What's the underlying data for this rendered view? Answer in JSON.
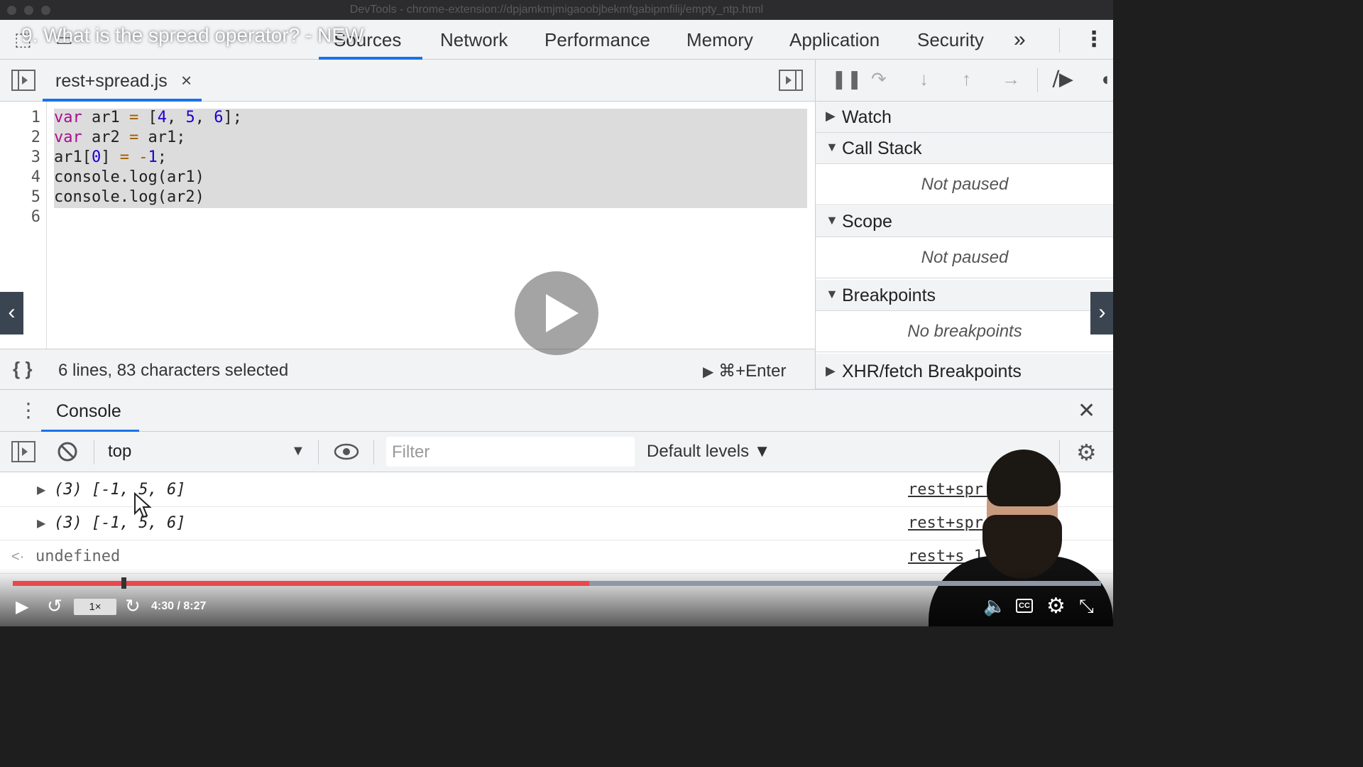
{
  "window": {
    "title": "DevTools - chrome-extension://dpjamkmjmigaoobjbekmfgabipmfilij/empty_ntp.html"
  },
  "video": {
    "title": "9. What is the spread operator? - NEW"
  },
  "devtools_tabs": [
    {
      "label": "Sources",
      "visible_text": "Sources"
    },
    {
      "label": "Network"
    },
    {
      "label": "Performance"
    },
    {
      "label": "Memory"
    },
    {
      "label": "Application"
    },
    {
      "label": "Security"
    }
  ],
  "more_tabs": "»",
  "editor": {
    "file_name": "rest+spread.js",
    "close_glyph": "×",
    "line_numbers": [
      "1",
      "2",
      "3",
      "4",
      "5",
      "6"
    ]
  },
  "status": {
    "selection": "6 lines, 83 characters selected",
    "run_shortcut": "⌘+Enter",
    "braces": "{ }"
  },
  "debugger": {
    "sections": [
      {
        "label": "Watch",
        "expanded": false
      },
      {
        "label": "Call Stack",
        "expanded": true,
        "body": "Not paused"
      },
      {
        "label": "Scope",
        "expanded": true,
        "body": "Not paused"
      },
      {
        "label": "Breakpoints",
        "expanded": true,
        "body": "No breakpoints"
      },
      {
        "label": "XHR/fetch Breakpoints",
        "expanded": false
      }
    ]
  },
  "console": {
    "tab_label": "Console",
    "context": "top",
    "filter_placeholder": "Filter",
    "levels": "Default levels ▼",
    "rows": [
      {
        "value": "(3) [-1, 5, 6]",
        "source": "rest+spr     :4"
      },
      {
        "value": "(3) [-1, 5, 6]",
        "source": "rest+spr     s:5"
      },
      {
        "value": "undefined",
        "source": "rest+s       1"
      }
    ]
  },
  "player": {
    "speed": "1×",
    "time": "4:30 / 8:27",
    "progress": 0.53,
    "buffer_marker": 0.1,
    "cc_label": "CC",
    "colors": {
      "played": "#e8484a",
      "unplayed": "#8e97a6"
    }
  }
}
